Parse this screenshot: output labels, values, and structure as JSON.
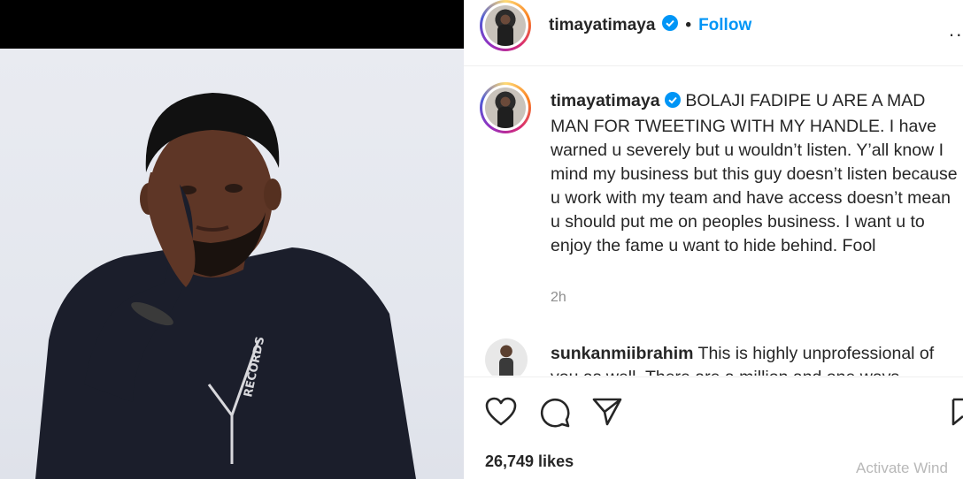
{
  "post": {
    "username": "timayatimaya",
    "follow_label": "Follow",
    "separator": "•",
    "more_label": "··",
    "caption": "BOLAJI FADIPE U ARE A MAD MAN FOR TWEETING WITH MY HANDLE. I have warned u severely but u wouldn’t listen. Y’all know I mind my business but this guy doesn’t listen because u work with my team and have access doesn’t mean u should put me on peoples business. I want u to enjoy the fame u want to hide behind. Fool",
    "timestamp": "2h",
    "likes": "26,749 likes"
  },
  "comment": {
    "username": "sunkanmiibrahim",
    "text": "This is highly unprofessional of you as well. There are a million and one ways"
  },
  "photo": {
    "shirt_text": "RECORDS"
  },
  "system": {
    "watermark": "Activate Wind"
  },
  "icons": {
    "verified": "verified-badge-icon",
    "like": "heart-icon",
    "comment": "comment-bubble-icon",
    "share": "paper-plane-icon",
    "save": "bookmark-icon"
  },
  "colors": {
    "follow": "#0095f6",
    "verified": "#0095f6",
    "text": "#262626",
    "muted": "#8e8e8e"
  }
}
